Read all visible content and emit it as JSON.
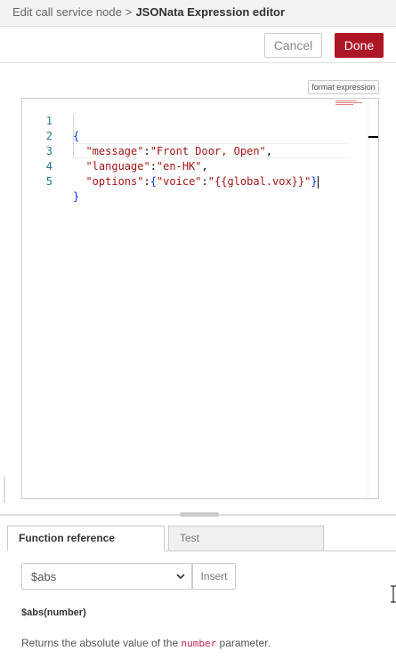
{
  "header": {
    "breadcrumb_parent": "Edit call service node",
    "separator": ">",
    "title": "JSONata Expression editor"
  },
  "toolbar": {
    "cancel_label": "Cancel",
    "done_label": "Done"
  },
  "editor": {
    "format_label": "format expression",
    "lines": [
      {
        "number": "1",
        "text": "{"
      },
      {
        "number": "2",
        "indent": "  ",
        "key": "\"message\"",
        "colon": ":",
        "value": "\"Front Door, Open\"",
        "trail": ","
      },
      {
        "number": "3",
        "indent": "  ",
        "key": "\"language\"",
        "colon": ":",
        "value": "\"en-HK\"",
        "trail": ","
      },
      {
        "number": "4",
        "indent": "  ",
        "key": "\"options\"",
        "colon": ":",
        "open": "{",
        "key2": "\"voice\"",
        "colon2": ":",
        "value": "\"{{global.vox}}\"",
        "close": "}"
      },
      {
        "number": "5",
        "text": "}"
      }
    ]
  },
  "tabs": {
    "function_reference": "Function reference",
    "test": "Test"
  },
  "reference": {
    "selected_function": "$abs",
    "insert_label": "Insert",
    "signature": "$abs(number)",
    "description_before": "Returns the absolute value of the ",
    "description_param": "number",
    "description_after": " parameter."
  },
  "colors": {
    "done_button": "#ad1625",
    "json_key": "#a31515",
    "brace": "#0431fa",
    "line_number": "#237893"
  }
}
